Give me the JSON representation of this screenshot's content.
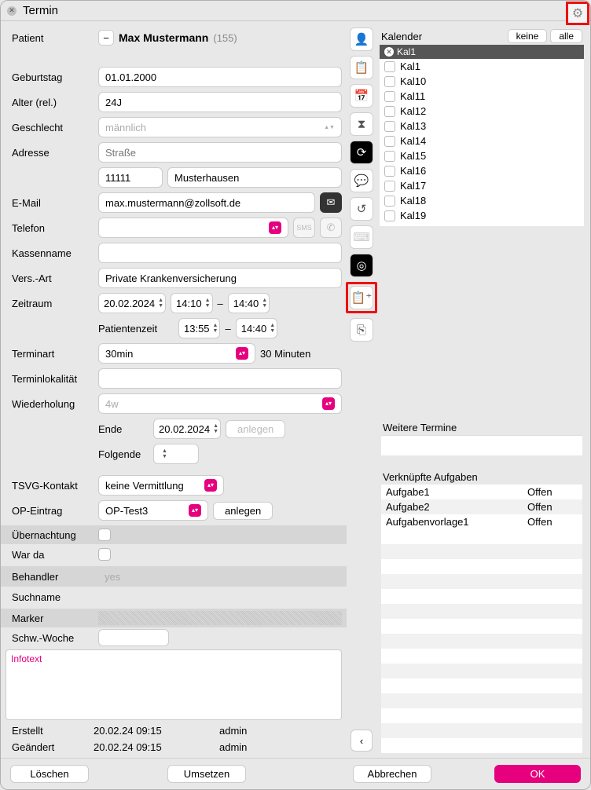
{
  "window": {
    "title": "Termin"
  },
  "patient": {
    "label": "Patient",
    "name": "Max Mustermann",
    "id": "(155)"
  },
  "fields": {
    "birthday": {
      "label": "Geburtstag",
      "value": "01.01.2000"
    },
    "age": {
      "label": "Alter (rel.)",
      "value": "24J"
    },
    "gender": {
      "label": "Geschlecht",
      "value": "männlich"
    },
    "address": {
      "label": "Adresse",
      "street_ph": "Straße",
      "zip": "11111",
      "city": "Musterhausen"
    },
    "email": {
      "label": "E-Mail",
      "value": "max.mustermann@zollsoft.de"
    },
    "phone": {
      "label": "Telefon",
      "value": ""
    },
    "kasse": {
      "label": "Kassenname",
      "value": ""
    },
    "versart": {
      "label": "Vers.-Art",
      "value": "Private Krankenversicherung"
    },
    "zeitraum": {
      "label": "Zeitraum",
      "date": "20.02.2024",
      "t1": "14:10",
      "t2": "14:40",
      "patzeit_label": "Patientenzeit",
      "pt1": "13:55",
      "pt2": "14:40",
      "dash": "–"
    },
    "terminart": {
      "label": "Terminart",
      "value": "30min",
      "hint": "30 Minuten"
    },
    "lokal": {
      "label": "Terminlokalität",
      "value": ""
    },
    "wdh": {
      "label": "Wiederholung",
      "placeholder": "4w",
      "ende_label": "Ende",
      "ende_val": "20.02.2024",
      "anlegen": "anlegen",
      "folgende_label": "Folgende",
      "folgende_val": ""
    },
    "tsvg": {
      "label": "TSVG-Kontakt",
      "value": "keine Vermittlung"
    },
    "op": {
      "label": "OP-Eintrag",
      "value": "OP-Test3",
      "anlegen": "anlegen"
    },
    "uebernachtung": {
      "label": "Übernachtung"
    },
    "warda": {
      "label": "War da"
    },
    "behandler": {
      "label": "Behandler",
      "value": "yes"
    },
    "suchname": {
      "label": "Suchname"
    },
    "marker": {
      "label": "Marker"
    },
    "schwwoche": {
      "label": "Schw.-Woche",
      "value": ""
    },
    "infotext": {
      "placeholder": "Infotext"
    }
  },
  "meta": {
    "erstellt": {
      "label": "Erstellt",
      "ts": "20.02.24 09:15",
      "user": "admin"
    },
    "geaendert": {
      "label": "Geändert",
      "ts": "20.02.24 09:15",
      "user": "admin"
    }
  },
  "calendar": {
    "title": "Kalender",
    "btn_none": "keine",
    "btn_all": "alle",
    "selected": "Kal1",
    "items": [
      "Kal1",
      "Kal10",
      "Kal11",
      "Kal12",
      "Kal13",
      "Kal14",
      "Kal15",
      "Kal16",
      "Kal17",
      "Kal18",
      "Kal19"
    ]
  },
  "weitere": {
    "title": "Weitere Termine"
  },
  "aufgaben": {
    "title": "Verknüpfte Aufgaben",
    "rows": [
      {
        "name": "Aufgabe1",
        "status": "Offen"
      },
      {
        "name": "Aufgabe2",
        "status": "Offen"
      },
      {
        "name": "Aufgabenvorlage1",
        "status": "Offen"
      }
    ]
  },
  "footer": {
    "delete": "Löschen",
    "move": "Umsetzen",
    "cancel": "Abbrechen",
    "ok": "OK"
  },
  "rail_icons": [
    "person",
    "clipboard",
    "calendar",
    "clock-person",
    "refresh-dark",
    "chat",
    "history",
    "cashbox",
    "target",
    "clipboard-add",
    "exit"
  ]
}
